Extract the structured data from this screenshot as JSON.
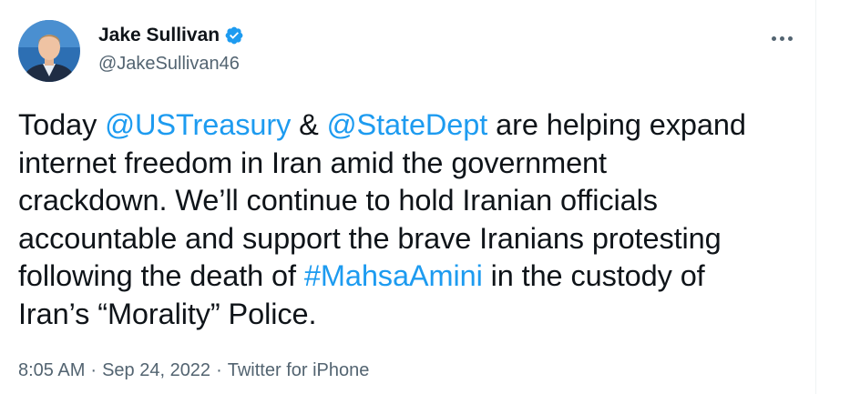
{
  "author": {
    "display_name": "Jake Sullivan",
    "handle": "@JakeSullivan46",
    "verified": true
  },
  "tweet": {
    "line1": {
      "t1": "Today ",
      "m1": "@USTreasury",
      "t2": " & ",
      "m2": "@StateDept",
      "t3": " are helping expand"
    },
    "line2": "internet freedom in Iran amid the government",
    "line3": "crackdown. We’ll continue to hold Iranian officials",
    "line4": "accountable and support the brave Iranians protesting",
    "line5": {
      "t1": "following the death of ",
      "hashtag": "#MahsaAmini",
      "t2": " in the custody of"
    },
    "line6": "Iran’s “Morality” Police."
  },
  "meta": {
    "time": "8:05 AM",
    "separator": "·",
    "date": "Sep 24, 2022",
    "source": "Twitter for iPhone"
  },
  "colors": {
    "link": "#1d9bf0",
    "verified_badge": "#1d9bf0",
    "text": "#0f1419",
    "secondary": "#536471"
  },
  "icons": {
    "verified": "verified-badge-icon",
    "more": "more-options-icon"
  }
}
